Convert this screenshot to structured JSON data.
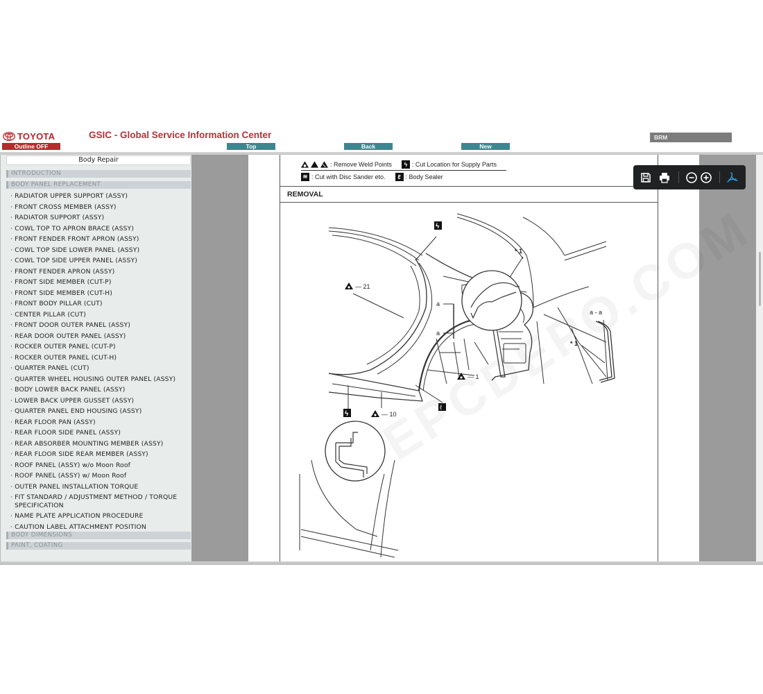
{
  "header": {
    "brand": "TOYOTA",
    "title": "GSIC - Global Service Information Center",
    "outline_button": "Outline OFF",
    "top_button": "Top",
    "back_button": "Back",
    "new_button": "New",
    "manual_code": "BRM",
    "colors": {
      "brand_red": "#b5252a",
      "nav_teal": "#3f8590"
    }
  },
  "sidebar": {
    "title": "Body Repair",
    "sections": [
      {
        "label": "INTRODUCTION"
      },
      {
        "label": "BODY PANEL REPLACEMENT"
      },
      {
        "label": "BODY DIMENSIONS"
      },
      {
        "label": "PAINT, COATING"
      }
    ],
    "items": [
      {
        "label": "RADIATOR UPPER SUPPORT (ASSY)"
      },
      {
        "label": "FRONT CROSS MEMBER (ASSY)"
      },
      {
        "label": "RADIATOR SUPPORT (ASSY)"
      },
      {
        "label": "COWL TOP TO APRON BRACE (ASSY)"
      },
      {
        "label": "FRONT FENDER FRONT APRON (ASSY)"
      },
      {
        "label": "COWL TOP SIDE LOWER PANEL (ASSY)"
      },
      {
        "label": "COWL TOP SIDE UPPER PANEL (ASSY)"
      },
      {
        "label": "FRONT FENDER APRON (ASSY)"
      },
      {
        "label": "FRONT SIDE MEMBER (CUT-P)"
      },
      {
        "label": "FRONT SIDE MEMBER (CUT-H)"
      },
      {
        "label": "FRONT BODY PILLAR (CUT)"
      },
      {
        "label": "CENTER PILLAR (CUT)"
      },
      {
        "label": "FRONT DOOR OUTER PANEL (ASSY)"
      },
      {
        "label": "REAR DOOR OUTER PANEL (ASSY)"
      },
      {
        "label": "ROCKER OUTER PANEL (CUT-P)"
      },
      {
        "label": "ROCKER OUTER PANEL (CUT-H)"
      },
      {
        "label": "QUARTER PANEL (CUT)"
      },
      {
        "label": "QUARTER WHEEL HOUSING OUTER PANEL (ASSY)"
      },
      {
        "label": "BODY LOWER BACK PANEL (ASSY)"
      },
      {
        "label": "LOWER BACK UPPER GUSSET (ASSY)"
      },
      {
        "label": "QUARTER PANEL END HOUSING (ASSY)"
      },
      {
        "label": "REAR FLOOR PAN (ASSY)"
      },
      {
        "label": "REAR FLOOR SIDE PANEL (ASSY)"
      },
      {
        "label": "REAR ABSORBER MOUNTING MEMBER (ASSY)"
      },
      {
        "label": "REAR FLOOR SIDE REAR MEMBER (ASSY)"
      },
      {
        "label": "ROOF PANEL (ASSY) w/o Moon Roof"
      },
      {
        "label": "ROOF PANEL (ASSY) w/ Moon Roof"
      },
      {
        "label": "OUTER PANEL INSTALLATION TORQUE"
      },
      {
        "label": "FIT STANDARD / ADJUSTMENT METHOD / TORQUE SPECIFICATION"
      },
      {
        "label": "NAME PLATE APPLICATION PROCEDURE"
      },
      {
        "label": "CAUTION LABEL ATTACHMENT POSITION"
      }
    ]
  },
  "document": {
    "legend": {
      "weld_points": ": Remove Weld Points",
      "cut_location": ": Cut Location for Supply Parts",
      "disc_sander": ": Cut with Disc Sander eto.",
      "body_sealer": ": Body Sealer"
    },
    "section_title": "REMOVAL",
    "diagram_labels": {
      "weld_21": "21",
      "weld_1": "1",
      "weld_10": "10",
      "callout_star1": "* 1",
      "section_a": "a",
      "section_view": "a - a",
      "section_star1": "* 1"
    },
    "watermark": "EPCDEPO.COM"
  },
  "pdf_toolbar": {
    "icons": [
      "save-icon",
      "print-icon",
      "zoom-out-icon",
      "zoom-in-icon",
      "acrobat-icon"
    ],
    "accent": "#2d9bd6"
  }
}
